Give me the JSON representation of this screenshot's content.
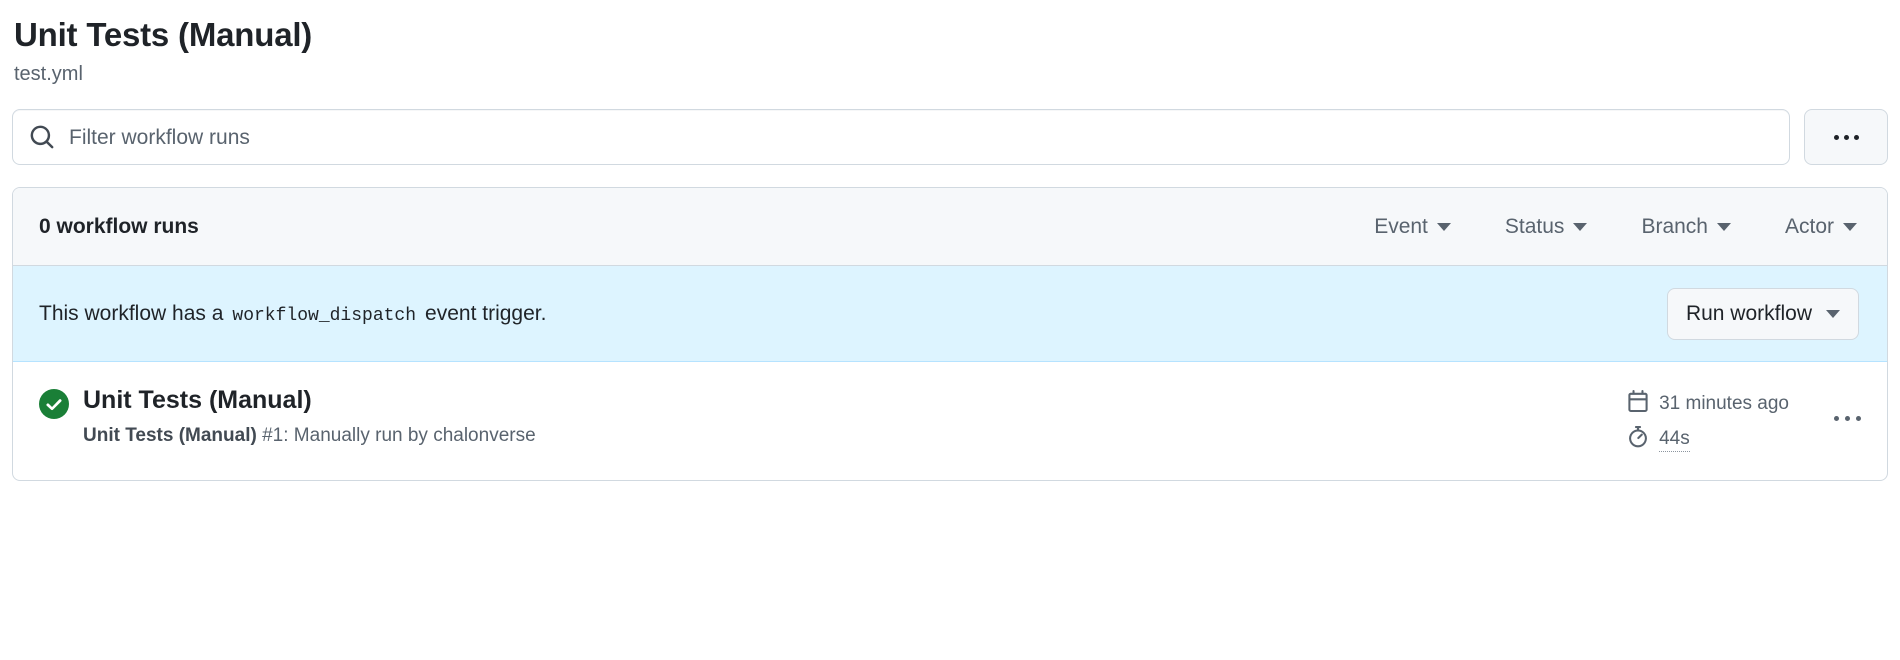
{
  "header": {
    "title": "Unit Tests (Manual)",
    "file": "test.yml"
  },
  "search": {
    "placeholder": "Filter workflow runs",
    "value": "",
    "icon": "search-icon"
  },
  "overflow_menu": {
    "label": "...",
    "icon": "kebab-horizontal-icon"
  },
  "runs_header": {
    "count_label": "0 workflow runs",
    "filters": [
      {
        "label": "Event"
      },
      {
        "label": "Status"
      },
      {
        "label": "Branch"
      },
      {
        "label": "Actor"
      }
    ]
  },
  "dispatch_banner": {
    "text_before": "This workflow has a",
    "event_name": "workflow_dispatch",
    "text_after": "event trigger.",
    "button_label": "Run workflow",
    "background": "#ddf4ff",
    "border": "#b6e3ff"
  },
  "runs": [
    {
      "status": "success",
      "status_icon": "check-circle-fill-icon",
      "status_color": "#1a7f37",
      "title": "Unit Tests (Manual)",
      "subtitle_strong": "Unit Tests (Manual)",
      "subtitle_rest": "#1: Manually run by chalonverse",
      "time_icon": "calendar-icon",
      "time": "31 minutes ago",
      "duration_icon": "stopwatch-icon",
      "duration": "44s",
      "row_menu_icon": "kebab-horizontal-icon"
    }
  ]
}
